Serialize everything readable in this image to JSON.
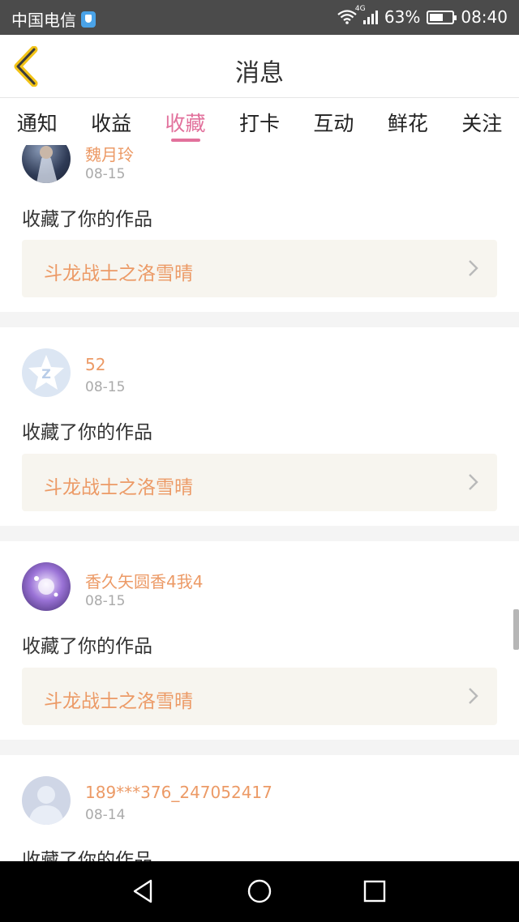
{
  "status_bar": {
    "carrier": "中国电信",
    "network": "4G",
    "battery": "63%",
    "battery_level": 0.63,
    "time": "08:40"
  },
  "header": {
    "title": "消息"
  },
  "tabs": [
    {
      "label": "通知",
      "active": false
    },
    {
      "label": "收益",
      "active": false
    },
    {
      "label": "收藏",
      "active": true
    },
    {
      "label": "打卡",
      "active": false
    },
    {
      "label": "互动",
      "active": false
    },
    {
      "label": "鲜花",
      "active": false
    },
    {
      "label": "关注",
      "active": false
    }
  ],
  "items": [
    {
      "user": "魏月玲",
      "date": "08-15",
      "action": "收藏了你的作品",
      "work": "斗龙战士之洛雪晴"
    },
    {
      "user": "52",
      "date": "08-15",
      "action": "收藏了你的作品",
      "work": "斗龙战士之洛雪晴"
    },
    {
      "user": "香久矢圆香4我4",
      "date": "08-15",
      "action": "收藏了你的作品",
      "work": "斗龙战士之洛雪晴"
    },
    {
      "user": "189***376_247052417",
      "date": "08-14",
      "action": "收藏了你的作品",
      "work": ""
    }
  ],
  "colors": {
    "accent": "#e2719c",
    "username": "#ec9a66",
    "status_bar": "#4b4b4b",
    "work_bg": "#f7f5ef"
  }
}
